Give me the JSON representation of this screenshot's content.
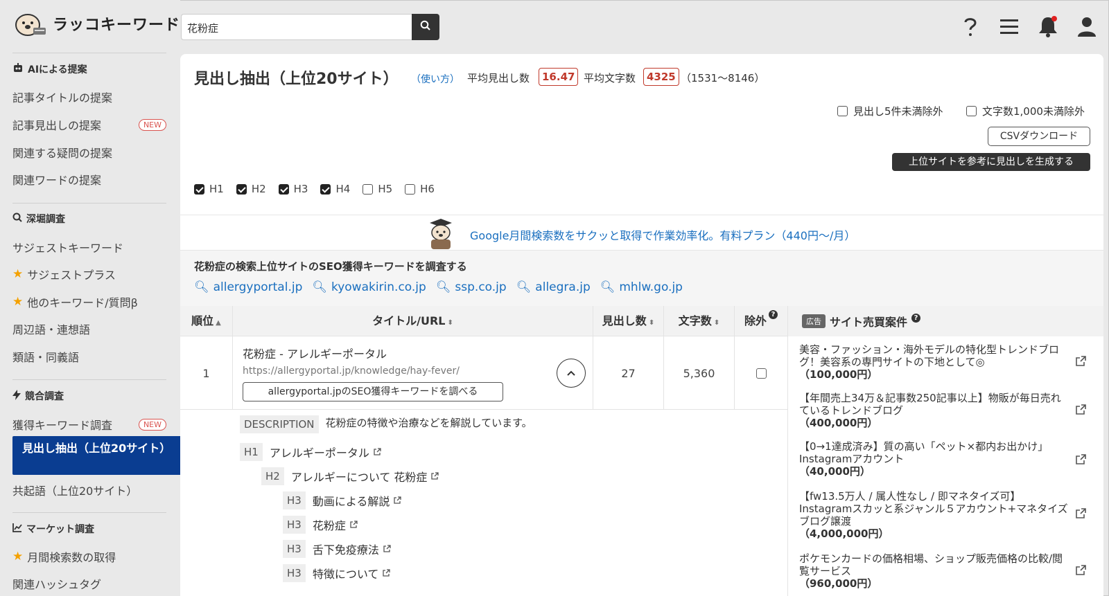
{
  "app": {
    "logo_text": "ラッコキーワード"
  },
  "search": {
    "value": "花粉症"
  },
  "sidebar": {
    "sections": [
      {
        "head": "AIによる提案",
        "items": [
          "記事タイトルの提案",
          "記事見出しの提案",
          "関連する疑問の提案",
          "関連ワードの提案"
        ]
      },
      {
        "head": "深堀調査",
        "items": [
          "サジェストキーワード",
          "サジェストプラス",
          "他のキーワード/質問β",
          "周辺語・連想語",
          "類語・同義語"
        ]
      },
      {
        "head": "競合調査",
        "items": [
          "獲得キーワード調査",
          "見出し抽出（上位20サイト）",
          "共起語（上位20サイト）"
        ]
      },
      {
        "head": "マーケット調査",
        "items": [
          "月間検索数の取得",
          "関連ハッシュタグ"
        ]
      }
    ],
    "new_badge": "NEW"
  },
  "main": {
    "title": "見出し抽出（上位20サイト）",
    "howto": "（使い方）",
    "avg_headings_label": "平均見出し数",
    "avg_headings": "16.47",
    "avg_chars_label": "平均文字数",
    "avg_chars": "4325",
    "range": "（1531〜8146）",
    "opt_exclude_5": "見出し5件未満除外",
    "opt_exclude_1000": "文字数1,000未満除外",
    "csv_button": "CSVダウンロード",
    "generate_button": "上位サイトを参考に見出しを生成する",
    "h_levels": [
      {
        "label": "H1",
        "checked": true
      },
      {
        "label": "H2",
        "checked": true
      },
      {
        "label": "H3",
        "checked": true
      },
      {
        "label": "H4",
        "checked": true
      },
      {
        "label": "H5",
        "checked": false
      },
      {
        "label": "H6",
        "checked": false
      }
    ],
    "banner": "Google月間検索数をサクッと取得で作業効率化。有料プラン（440円〜/月）",
    "seo_title": "花粉症の検索上位サイトのSEO獲得キーワードを調査する",
    "seo_links": [
      "allergyportal.jp",
      "kyowakirin.co.jp",
      "ssp.co.jp",
      "allegra.jp",
      "mhlw.go.jp"
    ]
  },
  "table": {
    "headers": {
      "rank": "順位",
      "title": "タイトル/URL",
      "headings": "見出し数",
      "chars": "文字数",
      "exclude": "除外"
    },
    "rows": [
      {
        "rank": "1",
        "title": "花粉症 - アレルギーポータル",
        "url": "https://allergyportal.jp/knowledge/hay-fever/",
        "seo_button": "allergyportal.jpのSEO獲得キーワードを調べる",
        "headings": "27",
        "chars": "5,360"
      }
    ],
    "detail": {
      "desc_tag": "DESCRIPTION",
      "desc": "花粉症の特徴や治療などを解説しています。",
      "headings": [
        {
          "tag": "H1",
          "text": "アレルギーポータル"
        },
        {
          "tag": "H2",
          "text": "アレルギーについて 花粉症"
        },
        {
          "tag": "H3",
          "text": "動画による解説"
        },
        {
          "tag": "H3",
          "text": "花粉症"
        },
        {
          "tag": "H3",
          "text": "舌下免疫療法"
        },
        {
          "tag": "H3",
          "text": "特徴について"
        }
      ]
    }
  },
  "ads": {
    "badge": "広告",
    "title": "サイト売買案件",
    "items": [
      {
        "text": "美容・ファッション・海外モデルの特化型トレンドブログ！美容系の専門サイトの下地として◎",
        "price": "（100,000円）"
      },
      {
        "text": "【年間売上34万＆記事数250記事以上】物販が毎日売れているトレンドブログ",
        "price": "（400,000円）"
      },
      {
        "text": "【0→1達成済み】質の高い「ペット×都内お出かけ」Instagramアカウント",
        "price": "（40,000円）"
      },
      {
        "text": "【fw13.5万人 / 属人性なし / 即マネタイズ可】Instagramスカッと系ジャンル５アカウント+マネタイズブログ譲渡",
        "price": "（4,000,000円）"
      },
      {
        "text": "ポケモンカードの価格相場、ショップ販売価格の比較/閲覧サービス",
        "price": "（960,000円）"
      }
    ]
  },
  "colors": {
    "accent": "#0a3d91",
    "link": "#1a6fbf",
    "stat": "#c0392b",
    "notify": "#e02020"
  }
}
